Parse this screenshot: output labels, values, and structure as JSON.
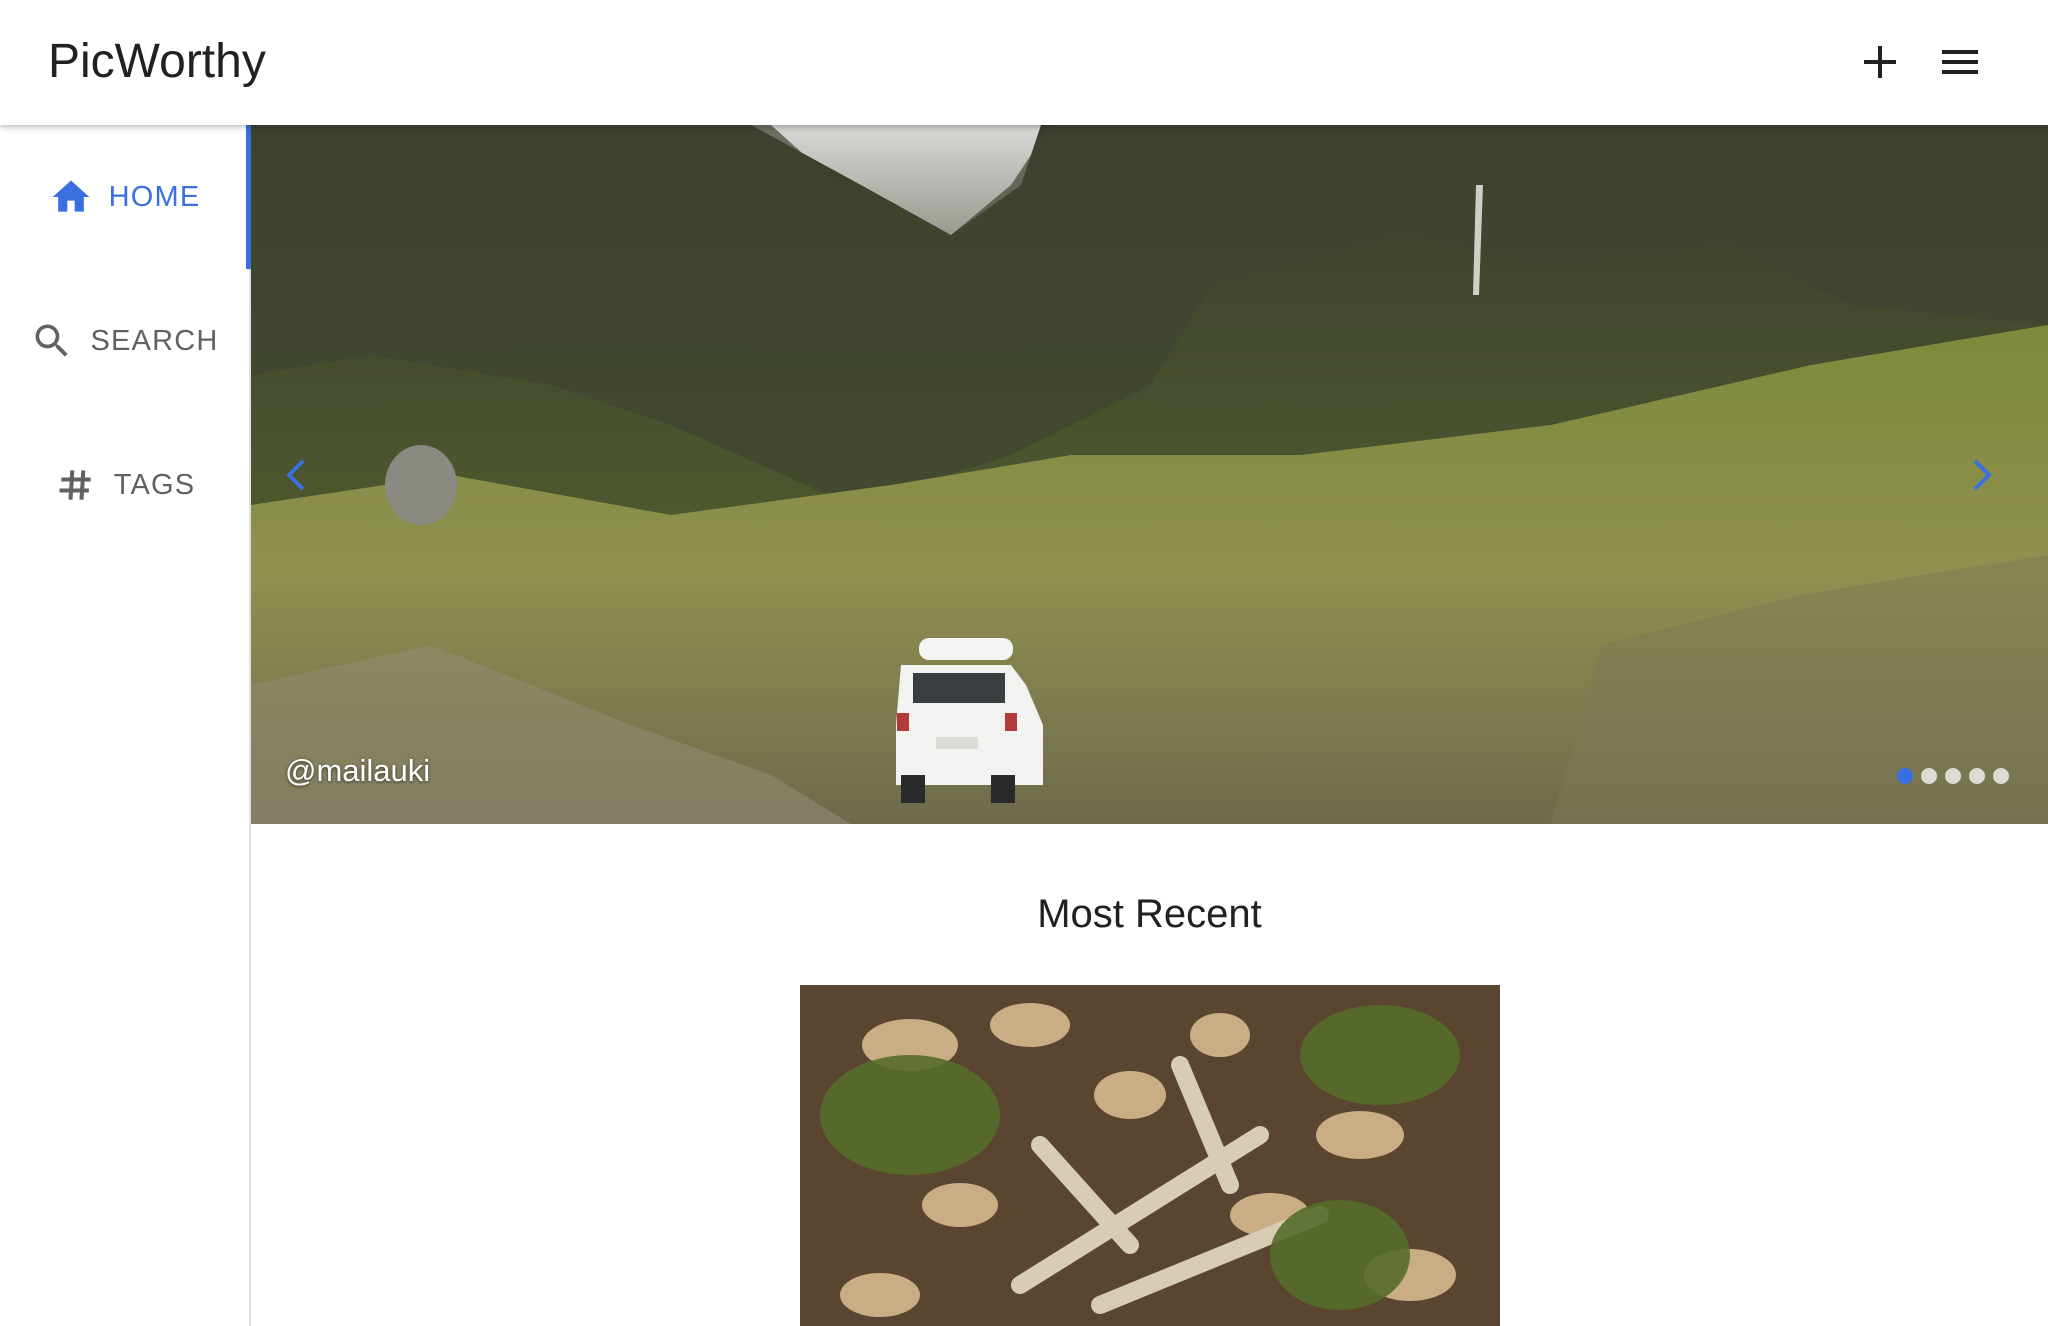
{
  "app": {
    "title": "PicWorthy"
  },
  "header": {
    "add_icon": "plus-icon",
    "menu_icon": "hamburger-menu-icon"
  },
  "sidebar": {
    "items": [
      {
        "label": "HOME",
        "icon": "home-icon",
        "active": true
      },
      {
        "label": "SEARCH",
        "icon": "search-icon",
        "active": false
      },
      {
        "label": "TAGS",
        "icon": "hashtag-icon",
        "active": false
      }
    ]
  },
  "carousel": {
    "credit": "@mailauki",
    "slide_count": 5,
    "active_index": 0,
    "prev_icon": "chevron-left-icon",
    "next_icon": "chevron-right-icon"
  },
  "main": {
    "section_title": "Most Recent"
  },
  "colors": {
    "accent": "#3a6fdf",
    "text": "#212121",
    "nav_text": "#616161"
  }
}
